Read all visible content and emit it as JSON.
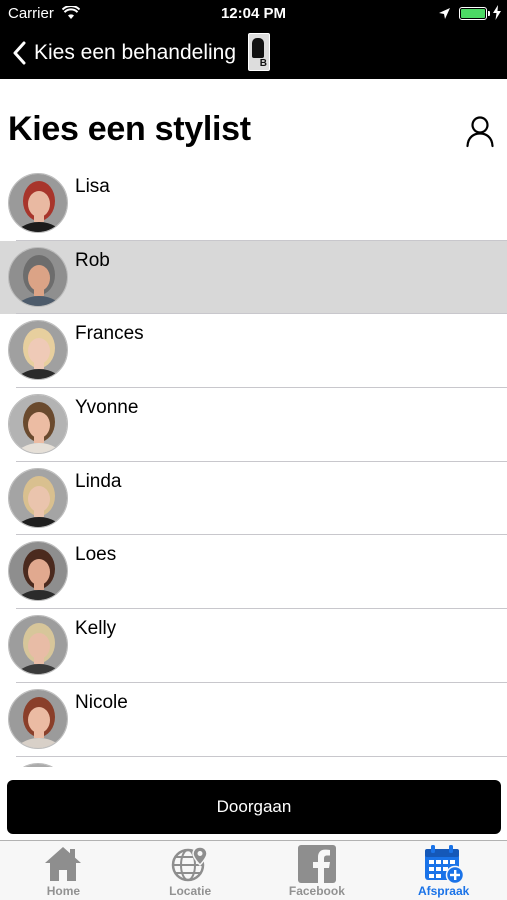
{
  "status_bar": {
    "carrier": "Carrier",
    "time": "12:04 PM"
  },
  "nav": {
    "back_label": "Kies een behandeling",
    "logo_letter": "B"
  },
  "page": {
    "title": "Kies een stylist"
  },
  "stylists": [
    {
      "name": "Lisa",
      "selected": false,
      "hair": "#a8352b",
      "skin": "#e9b9a2",
      "bg": "#9a9a9a",
      "shirt": "#1c1c1c"
    },
    {
      "name": "Rob",
      "selected": true,
      "hair": "#6d6d6d",
      "skin": "#dba386",
      "bg": "#8f8f8f",
      "shirt": "#4d5b6b"
    },
    {
      "name": "Frances",
      "selected": false,
      "hair": "#e7cf9e",
      "skin": "#efcab7",
      "bg": "#a0a0a0",
      "shirt": "#2a2a2a"
    },
    {
      "name": "Yvonne",
      "selected": false,
      "hair": "#6a4a2e",
      "skin": "#ecbca3",
      "bg": "#b3b3b3",
      "shirt": "#e6e0d8"
    },
    {
      "name": "Linda",
      "selected": false,
      "hair": "#d9c08f",
      "skin": "#eac4ad",
      "bg": "#a4a4a4",
      "shirt": "#1f1f1f"
    },
    {
      "name": "Loes",
      "selected": false,
      "hair": "#4b2a1e",
      "skin": "#e1a98f",
      "bg": "#8e8e8e",
      "shirt": "#2b2b2b"
    },
    {
      "name": "Kelly",
      "selected": false,
      "hair": "#d7c69a",
      "skin": "#e8bca6",
      "bg": "#9d9d9d",
      "shirt": "#3a3a3a"
    },
    {
      "name": "Nicole",
      "selected": false,
      "hair": "#8a3f2a",
      "skin": "#ebbba3",
      "bg": "#9b9b9b",
      "shirt": "#d8d0c8"
    },
    {
      "name": "",
      "selected": false,
      "hair": "#777777",
      "skin": "#dddddd",
      "bg": "#aaaaaa",
      "shirt": "#555555"
    }
  ],
  "continue_label": "Doorgaan",
  "tabs": [
    {
      "label": "Home",
      "icon": "home-icon",
      "active": false
    },
    {
      "label": "Locatie",
      "icon": "globe-pin-icon",
      "active": false
    },
    {
      "label": "Facebook",
      "icon": "facebook-icon",
      "active": false
    },
    {
      "label": "Afspraak",
      "icon": "calendar-add-icon",
      "active": true
    }
  ],
  "colors": {
    "accent": "#1a73e8",
    "inactive": "#929292",
    "selected_row": "#d8d8d8",
    "bar": "#000000"
  }
}
